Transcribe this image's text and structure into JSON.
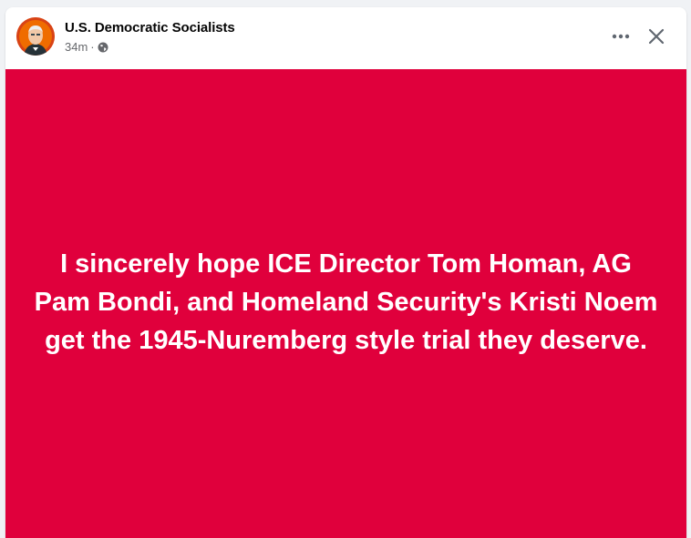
{
  "post": {
    "author": "U.S. Democratic Socialists",
    "timestamp": "34m",
    "separator": "·",
    "privacy_icon": "globe-icon",
    "avatar_icon": "profile-avatar",
    "text": "I sincerely hope ICE Director Tom Homan, AG Pam Bondi, and Homeland Security's Kristi Noem get the 1945-Nuremberg style trial they deserve.",
    "background_color": "#e0003c"
  },
  "actions": {
    "more_icon": "more-options-icon",
    "close_icon": "close-icon"
  }
}
